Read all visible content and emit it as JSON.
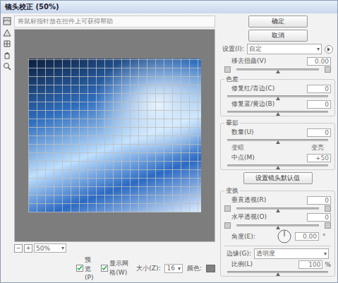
{
  "window": {
    "title": "镜头校正 (50%)"
  },
  "hint": "将鼠标指针放在控件上可获得帮助",
  "zoom": {
    "minus": "−",
    "plus": "+",
    "value": "50%"
  },
  "options": {
    "preview": {
      "label": "预览(P)",
      "checked": true
    },
    "grid": {
      "label": "显示网格(W)",
      "checked": true
    },
    "size": {
      "label": "大小(Z):",
      "value": "16"
    },
    "color": {
      "label": "颜色:"
    }
  },
  "buttons": [
    "确定",
    "取消"
  ],
  "settings": {
    "label": "设置(I):",
    "value": "自定"
  },
  "distortion": {
    "label": "移去扭曲(V)",
    "value": "0.00",
    "level": 0.5
  },
  "chromatic": {
    "title": "色差",
    "sliders": [
      {
        "label": "修复红/青边(C)",
        "value": "0",
        "level": 0.5
      },
      {
        "label": "修复蓝/黄边(B)",
        "value": "0",
        "level": 0.5
      }
    ]
  },
  "vignette": {
    "title": "晕影",
    "amount": {
      "label": "数量(U)",
      "value": "0",
      "level": 0.5
    },
    "ends": [
      "变暗",
      "变亮"
    ],
    "midpoint": {
      "label": "中点(M)",
      "value": "+50",
      "level": 0.5
    }
  },
  "default_button": "设置镜头默认值",
  "transform": {
    "title": "变换",
    "sliders": [
      {
        "label": "垂直透视(R)",
        "value": "0",
        "level": 0.5
      },
      {
        "label": "水平透视(O)",
        "value": "0",
        "level": 0.5
      }
    ],
    "angle": {
      "label": "角度(E):",
      "value": "0.00",
      "unit": "°"
    }
  },
  "edge": {
    "label": "边缘(G):",
    "value": "透明度"
  },
  "scale": {
    "label": "比例(L)",
    "value": "100",
    "unit": "%",
    "level": 0.5
  }
}
